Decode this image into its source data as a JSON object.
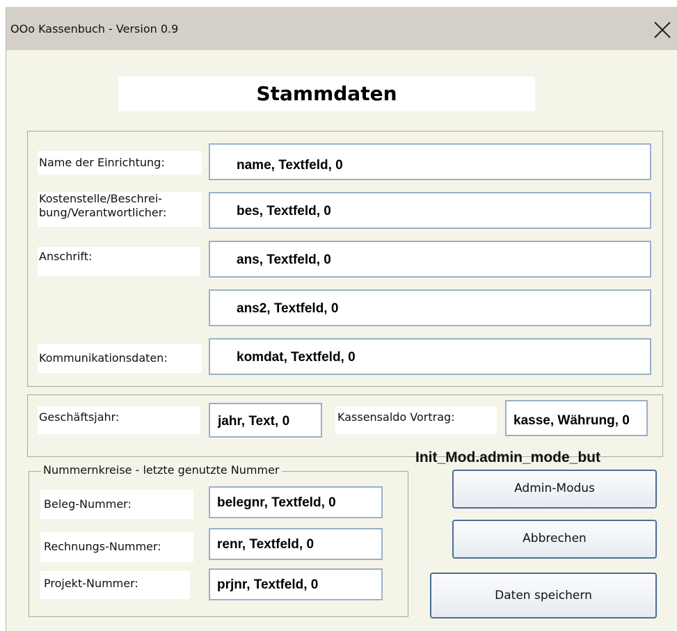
{
  "window": {
    "title": "OOo Kassenbuch  - Version 0.9"
  },
  "heading": "Stammdaten",
  "stammdaten": {
    "name_label": "Name der Einrichtung:",
    "name_value": "name, Textfeld, 0",
    "bes_label_1": "Kostenstelle/Beschrei-",
    "bes_label_2": "bung/Verantwortlicher:",
    "bes_value": "bes, Textfeld, 0",
    "ans_label": "Anschrift:",
    "ans_value": "ans, Textfeld, 0",
    "ans2_value": "ans2, Textfeld, 0",
    "komdat_label": "Kommunikationsdaten:",
    "komdat_value": "komdat, Textfeld, 0"
  },
  "finanzen": {
    "jahr_label": "Geschäftsjahr:",
    "jahr_value": "jahr, Text, 0",
    "kasse_label": "Kassensaldo Vortrag:",
    "kasse_value": "kasse, Währung, 0"
  },
  "nummernkreise": {
    "caption": "Nummernkreise  - letzte genutzte Nummer",
    "beleg_label": "Beleg-Nummer:",
    "beleg_value": "belegnr, Textfeld, 0",
    "rechnung_label": "Rechnungs-Nummer:",
    "rechnung_value": "renr, Textfeld, 0",
    "projekt_label": "Projekt-Nummer:",
    "projekt_value": "prjnr, Textfeld, 0"
  },
  "macro_label": "Init_Mod.admin_mode_but",
  "buttons": {
    "admin": "Admin-Modus",
    "cancel": "Abbrechen",
    "save": "Daten speichern"
  },
  "icons": {
    "close": "close-icon"
  }
}
